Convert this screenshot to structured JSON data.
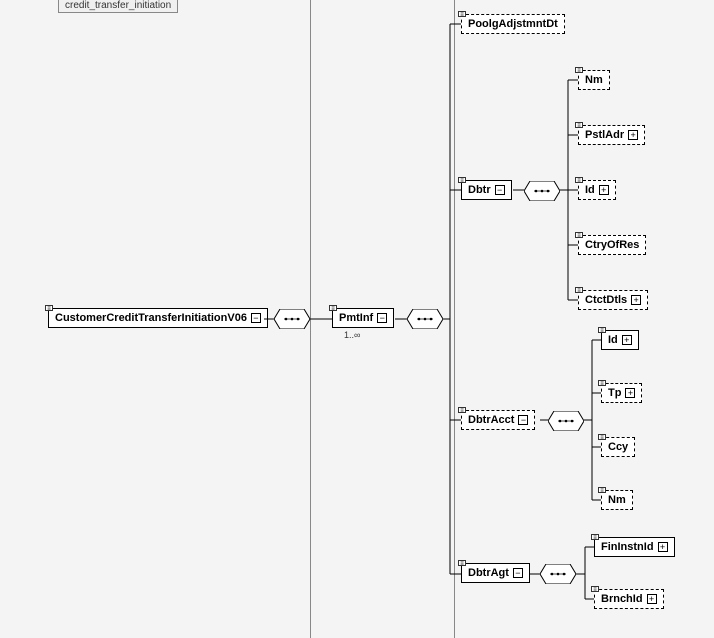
{
  "header": {
    "tab_label": "credit_transfer_initiation"
  },
  "nodes": {
    "root": {
      "label": "CustomerCreditTransferInitiationV06"
    },
    "pmtinf": {
      "label": "PmtInf",
      "occurrence": "1..∞"
    },
    "poolg": {
      "label": "PoolgAdjstmntDt"
    },
    "dbtr": {
      "label": "Dbtr"
    },
    "dbtr_nm": {
      "label": "Nm"
    },
    "dbtr_pstladr": {
      "label": "PstlAdr"
    },
    "dbtr_id": {
      "label": "Id"
    },
    "dbtr_ctryofres": {
      "label": "CtryOfRes"
    },
    "dbtr_ctctdtls": {
      "label": "CtctDtls"
    },
    "dbtracct": {
      "label": "DbtrAcct"
    },
    "dbtracct_id": {
      "label": "Id"
    },
    "dbtracct_tp": {
      "label": "Tp"
    },
    "dbtracct_ccy": {
      "label": "Ccy"
    },
    "dbtracct_nm": {
      "label": "Nm"
    },
    "dbtragt": {
      "label": "DbtrAgt"
    },
    "dbtragt_fininstnid": {
      "label": "FinInstnId"
    },
    "dbtragt_brnchid": {
      "label": "BrnchId"
    }
  }
}
